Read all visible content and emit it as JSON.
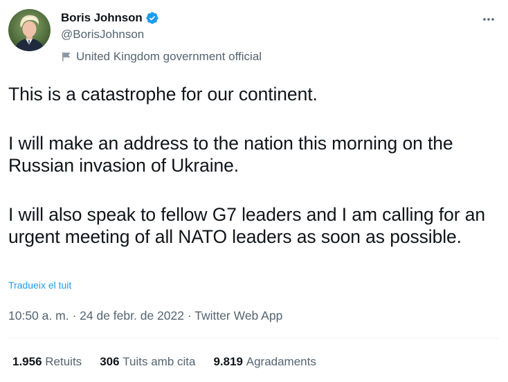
{
  "author": {
    "display_name": "Boris Johnson",
    "handle": "@BorisJohnson",
    "label": "United Kingdom government official"
  },
  "tweet": {
    "paragraphs": [
      "This is a catastrophe for our continent.",
      "I will make an address to the nation this morning on the Russian invasion of Ukraine.",
      "I will also speak to fellow G7 leaders and I am calling for an urgent meeting of all NATO leaders as soon as possible."
    ],
    "translate_link": "Tradueix el tuit",
    "time": "10:50 a. m.",
    "separator": "·",
    "date": "24 de febr. de 2022",
    "source": "Twitter Web App"
  },
  "stats": {
    "retweets_count": "1.956",
    "retweets_label": "Retuits",
    "quotes_count": "306",
    "quotes_label": "Tuits amb cita",
    "likes_count": "9.819",
    "likes_label": "Agradaments"
  },
  "colors": {
    "verified": "#1d9bf0",
    "link": "#1d9bf0",
    "secondary_text": "#536471"
  },
  "icons": {
    "verified": "verified-badge-icon",
    "label": "flag-icon",
    "more": "more-horizontal-icon"
  }
}
